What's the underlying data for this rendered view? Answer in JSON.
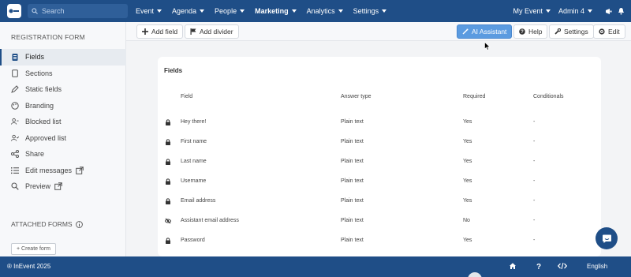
{
  "nav": {
    "search_placeholder": "Search",
    "menu": [
      {
        "label": "Event"
      },
      {
        "label": "Agenda"
      },
      {
        "label": "People"
      },
      {
        "label": "Marketing"
      },
      {
        "label": "Analytics"
      },
      {
        "label": "Settings"
      }
    ],
    "my_event": "My Event",
    "admin": "Admin 4"
  },
  "sidebar": {
    "heading": "REGISTRATION FORM",
    "items": [
      {
        "label": "Fields",
        "icon": "clipboard-icon"
      },
      {
        "label": "Sections",
        "icon": "page-icon"
      },
      {
        "label": "Static fields",
        "icon": "pencil-icon"
      },
      {
        "label": "Branding",
        "icon": "palette-icon"
      },
      {
        "label": "Blocked list",
        "icon": "user-block-icon"
      },
      {
        "label": "Approved list",
        "icon": "user-check-icon"
      },
      {
        "label": "Share",
        "icon": "share-icon"
      },
      {
        "label": "Edit messages",
        "icon": "list-icon"
      },
      {
        "label": "Preview",
        "icon": "search-icon"
      }
    ],
    "attached_heading": "ATTACHED FORMS",
    "create_form": "+ Create form"
  },
  "toolbar": {
    "add_field": "Add field",
    "add_divider": "Add divider",
    "ai_assistant": "AI Assistant",
    "help": "Help",
    "settings": "Settings",
    "edit": "Edit"
  },
  "panel": {
    "title": "Fields",
    "columns": {
      "field": "Field",
      "answer_type": "Answer type",
      "required": "Required",
      "conditionals": "Conditionals"
    },
    "rows": [
      {
        "field": "Hey there!",
        "answer_type": "Plain text",
        "required": "Yes",
        "conditionals": "-",
        "icon": "lock-icon"
      },
      {
        "field": "First name",
        "answer_type": "Plain text",
        "required": "Yes",
        "conditionals": "-",
        "icon": "lock-icon"
      },
      {
        "field": "Last name",
        "answer_type": "Plain text",
        "required": "Yes",
        "conditionals": "-",
        "icon": "lock-icon"
      },
      {
        "field": "Username",
        "answer_type": "Plain text",
        "required": "Yes",
        "conditionals": "-",
        "icon": "lock-icon"
      },
      {
        "field": "Email address",
        "answer_type": "Plain text",
        "required": "Yes",
        "conditionals": "-",
        "icon": "lock-icon"
      },
      {
        "field": "Assistant email address",
        "answer_type": "Plain text",
        "required": "No",
        "conditionals": "-",
        "icon": "eye-slash-icon"
      },
      {
        "field": "Password",
        "answer_type": "Plain text",
        "required": "Yes",
        "conditionals": "-",
        "icon": "lock-icon"
      }
    ]
  },
  "footer": {
    "copyright": "® InEvent 2025",
    "language": "English"
  },
  "colors": {
    "brand": "#1f4e87",
    "accent": "#5b9be0"
  }
}
